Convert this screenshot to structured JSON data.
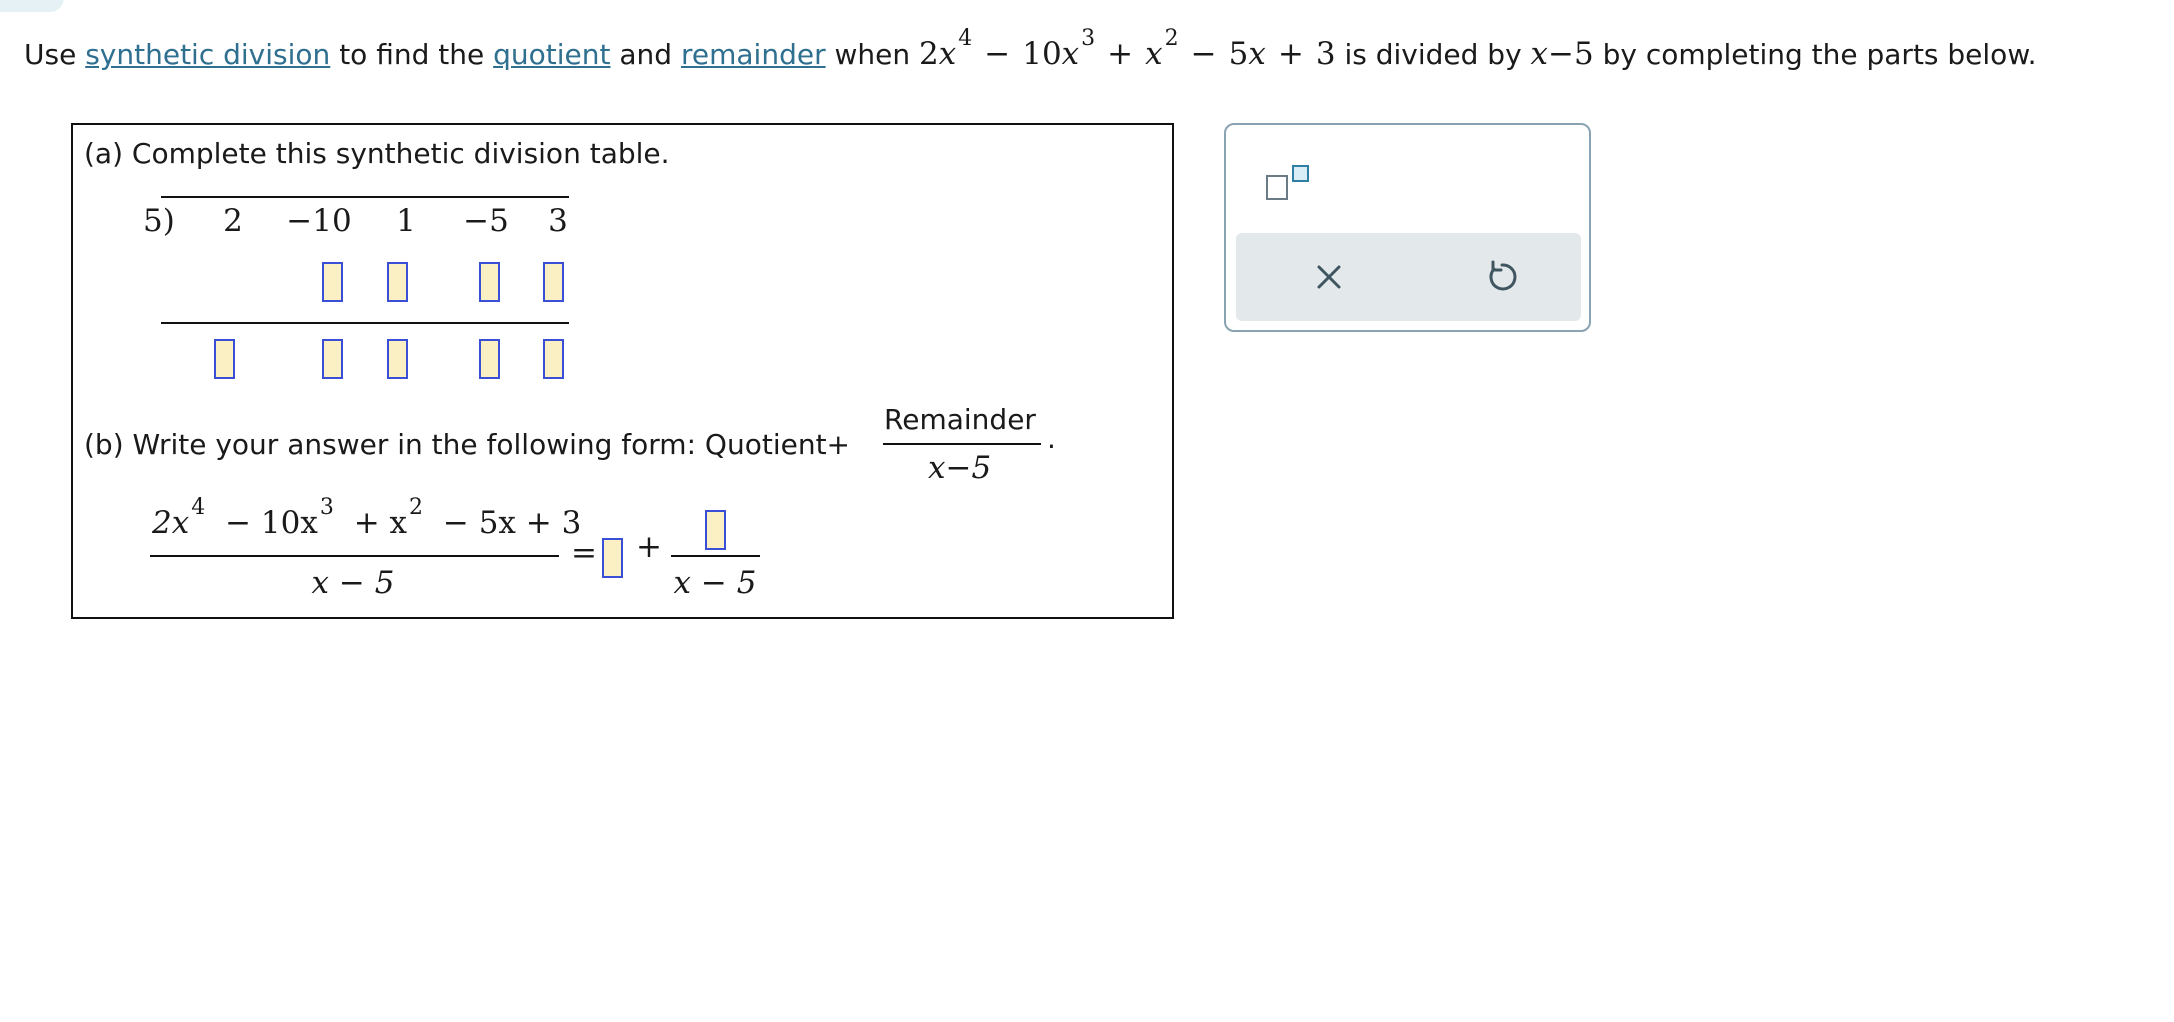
{
  "prompt": {
    "lead": "Use",
    "link_synthetic_division": "synthetic division",
    "to_find_the": "to find the",
    "link_quotient": "quotient",
    "and": "and",
    "link_remainder": "remainder",
    "when": "when",
    "t1_coef": "2",
    "t1_var": "x",
    "t1_exp": "4",
    "op1": "−",
    "t2_coef": "10",
    "t2_var": "x",
    "t2_exp": "3",
    "op2": "+",
    "t3_var": "x",
    "t3_exp": "2",
    "op3": "−",
    "t4_coef": "5",
    "t4_var": "x",
    "op4": "+",
    "t5": "3",
    "is_divided_by": "is divided by",
    "divisor_var": "x",
    "divisor_rest": "−5",
    "by_completing": "by completing the parts below."
  },
  "part_a": {
    "label": "(a)",
    "instruction": "Complete this synthetic division table.",
    "divisor": "5)",
    "coefficients": [
      "2",
      "−10",
      "1",
      "−5",
      "3"
    ]
  },
  "part_b": {
    "label": "(b)",
    "instruction": "Write your answer in the following form: Quotient",
    "plus": "+",
    "remainder_word": "Remainder",
    "form_denominator": "x−5",
    "period": ".",
    "numerator": "2x⁴ − 10x³ + x² − 5x + 3",
    "n_coef1": "2x",
    "n_exp1": "4",
    "n_mid1": "− 10x",
    "n_exp2": "3",
    "n_mid2": "+ x",
    "n_exp3": "2",
    "n_tail": "− 5x + 3",
    "denominator": "x − 5",
    "equals": "=",
    "answer_plus": "+",
    "answer_denominator": "x − 5"
  },
  "tools": {
    "exponent_tool": "superscript-tool",
    "clear_icon": "close-icon",
    "reset_icon": "undo-icon"
  },
  "colors": {
    "link": "#2f6f8f",
    "answer_fill": "#fbf0c4",
    "answer_border": "#3a4fd6"
  }
}
